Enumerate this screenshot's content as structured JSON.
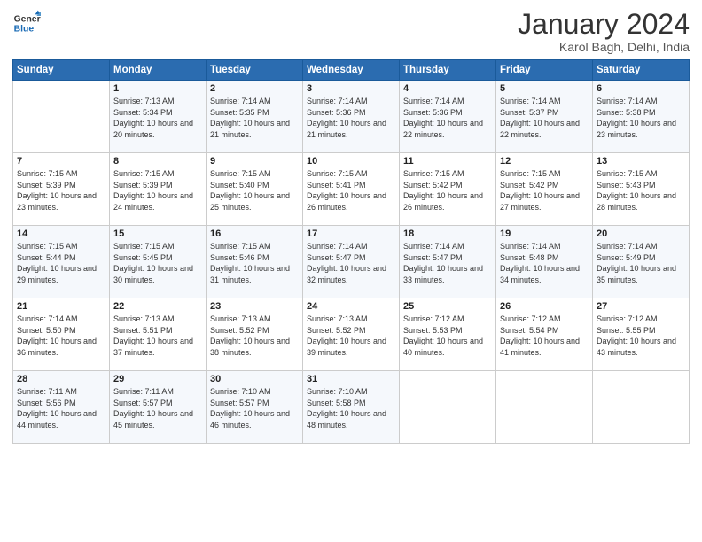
{
  "header": {
    "logo_line1": "General",
    "logo_line2": "Blue",
    "month": "January 2024",
    "location": "Karol Bagh, Delhi, India"
  },
  "weekdays": [
    "Sunday",
    "Monday",
    "Tuesday",
    "Wednesday",
    "Thursday",
    "Friday",
    "Saturday"
  ],
  "weeks": [
    [
      {
        "day": "",
        "sunrise": "",
        "sunset": "",
        "daylight": ""
      },
      {
        "day": "1",
        "sunrise": "7:13 AM",
        "sunset": "5:34 PM",
        "daylight": "10 hours and 20 minutes."
      },
      {
        "day": "2",
        "sunrise": "7:14 AM",
        "sunset": "5:35 PM",
        "daylight": "10 hours and 21 minutes."
      },
      {
        "day": "3",
        "sunrise": "7:14 AM",
        "sunset": "5:36 PM",
        "daylight": "10 hours and 21 minutes."
      },
      {
        "day": "4",
        "sunrise": "7:14 AM",
        "sunset": "5:36 PM",
        "daylight": "10 hours and 22 minutes."
      },
      {
        "day": "5",
        "sunrise": "7:14 AM",
        "sunset": "5:37 PM",
        "daylight": "10 hours and 22 minutes."
      },
      {
        "day": "6",
        "sunrise": "7:14 AM",
        "sunset": "5:38 PM",
        "daylight": "10 hours and 23 minutes."
      }
    ],
    [
      {
        "day": "7",
        "sunrise": "7:15 AM",
        "sunset": "5:39 PM",
        "daylight": "10 hours and 23 minutes."
      },
      {
        "day": "8",
        "sunrise": "7:15 AM",
        "sunset": "5:39 PM",
        "daylight": "10 hours and 24 minutes."
      },
      {
        "day": "9",
        "sunrise": "7:15 AM",
        "sunset": "5:40 PM",
        "daylight": "10 hours and 25 minutes."
      },
      {
        "day": "10",
        "sunrise": "7:15 AM",
        "sunset": "5:41 PM",
        "daylight": "10 hours and 26 minutes."
      },
      {
        "day": "11",
        "sunrise": "7:15 AM",
        "sunset": "5:42 PM",
        "daylight": "10 hours and 26 minutes."
      },
      {
        "day": "12",
        "sunrise": "7:15 AM",
        "sunset": "5:42 PM",
        "daylight": "10 hours and 27 minutes."
      },
      {
        "day": "13",
        "sunrise": "7:15 AM",
        "sunset": "5:43 PM",
        "daylight": "10 hours and 28 minutes."
      }
    ],
    [
      {
        "day": "14",
        "sunrise": "7:15 AM",
        "sunset": "5:44 PM",
        "daylight": "10 hours and 29 minutes."
      },
      {
        "day": "15",
        "sunrise": "7:15 AM",
        "sunset": "5:45 PM",
        "daylight": "10 hours and 30 minutes."
      },
      {
        "day": "16",
        "sunrise": "7:15 AM",
        "sunset": "5:46 PM",
        "daylight": "10 hours and 31 minutes."
      },
      {
        "day": "17",
        "sunrise": "7:14 AM",
        "sunset": "5:47 PM",
        "daylight": "10 hours and 32 minutes."
      },
      {
        "day": "18",
        "sunrise": "7:14 AM",
        "sunset": "5:47 PM",
        "daylight": "10 hours and 33 minutes."
      },
      {
        "day": "19",
        "sunrise": "7:14 AM",
        "sunset": "5:48 PM",
        "daylight": "10 hours and 34 minutes."
      },
      {
        "day": "20",
        "sunrise": "7:14 AM",
        "sunset": "5:49 PM",
        "daylight": "10 hours and 35 minutes."
      }
    ],
    [
      {
        "day": "21",
        "sunrise": "7:14 AM",
        "sunset": "5:50 PM",
        "daylight": "10 hours and 36 minutes."
      },
      {
        "day": "22",
        "sunrise": "7:13 AM",
        "sunset": "5:51 PM",
        "daylight": "10 hours and 37 minutes."
      },
      {
        "day": "23",
        "sunrise": "7:13 AM",
        "sunset": "5:52 PM",
        "daylight": "10 hours and 38 minutes."
      },
      {
        "day": "24",
        "sunrise": "7:13 AM",
        "sunset": "5:52 PM",
        "daylight": "10 hours and 39 minutes."
      },
      {
        "day": "25",
        "sunrise": "7:12 AM",
        "sunset": "5:53 PM",
        "daylight": "10 hours and 40 minutes."
      },
      {
        "day": "26",
        "sunrise": "7:12 AM",
        "sunset": "5:54 PM",
        "daylight": "10 hours and 41 minutes."
      },
      {
        "day": "27",
        "sunrise": "7:12 AM",
        "sunset": "5:55 PM",
        "daylight": "10 hours and 43 minutes."
      }
    ],
    [
      {
        "day": "28",
        "sunrise": "7:11 AM",
        "sunset": "5:56 PM",
        "daylight": "10 hours and 44 minutes."
      },
      {
        "day": "29",
        "sunrise": "7:11 AM",
        "sunset": "5:57 PM",
        "daylight": "10 hours and 45 minutes."
      },
      {
        "day": "30",
        "sunrise": "7:10 AM",
        "sunset": "5:57 PM",
        "daylight": "10 hours and 46 minutes."
      },
      {
        "day": "31",
        "sunrise": "7:10 AM",
        "sunset": "5:58 PM",
        "daylight": "10 hours and 48 minutes."
      },
      {
        "day": "",
        "sunrise": "",
        "sunset": "",
        "daylight": ""
      },
      {
        "day": "",
        "sunrise": "",
        "sunset": "",
        "daylight": ""
      },
      {
        "day": "",
        "sunrise": "",
        "sunset": "",
        "daylight": ""
      }
    ]
  ]
}
